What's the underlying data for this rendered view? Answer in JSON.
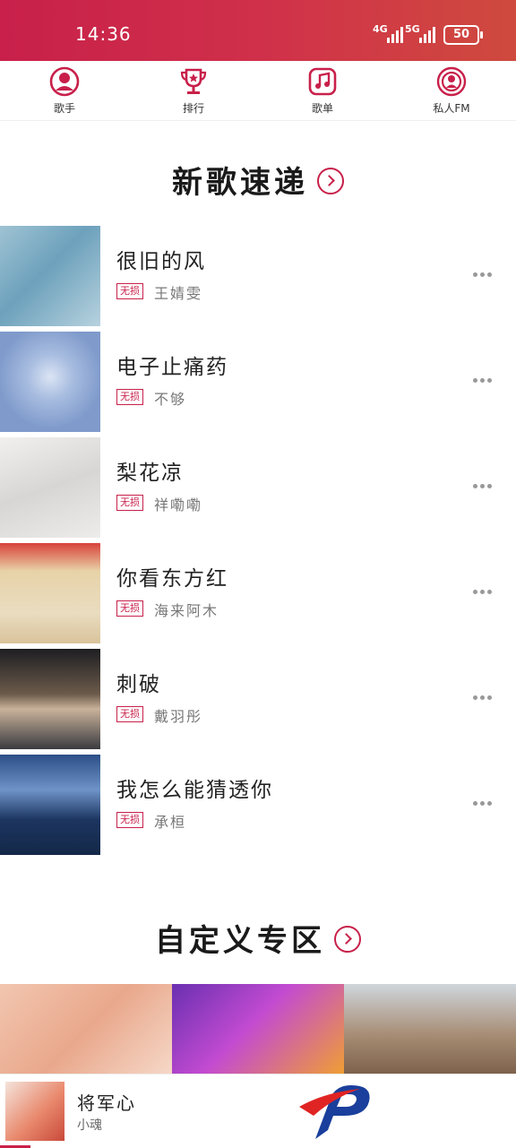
{
  "status_bar": {
    "time": "14:36",
    "network1": "4G",
    "network2": "5G",
    "battery": "50"
  },
  "nav": [
    {
      "label": "歌手",
      "icon": "singer-icon"
    },
    {
      "label": "排行",
      "icon": "trophy-icon"
    },
    {
      "label": "歌单",
      "icon": "music-note-icon"
    },
    {
      "label": "私人FM",
      "icon": "radio-icon"
    }
  ],
  "new_songs": {
    "title": "新歌速递",
    "quality_tag": "无损",
    "items": [
      {
        "name": "很旧的风",
        "artist": "王婧雯"
      },
      {
        "name": "电子止痛药",
        "artist": "不够"
      },
      {
        "name": "梨花凉",
        "artist": "祥嘞嘞"
      },
      {
        "name": "你看东方红",
        "artist": "海来阿木"
      },
      {
        "name": "刺破",
        "artist": "戴羽彤"
      },
      {
        "name": "我怎么能猜透你",
        "artist": "承桓"
      }
    ]
  },
  "custom_zone": {
    "title": "自定义专区"
  },
  "player": {
    "title": "将军心",
    "artist": "小魂"
  },
  "colors": {
    "accent": "#c8204a"
  }
}
